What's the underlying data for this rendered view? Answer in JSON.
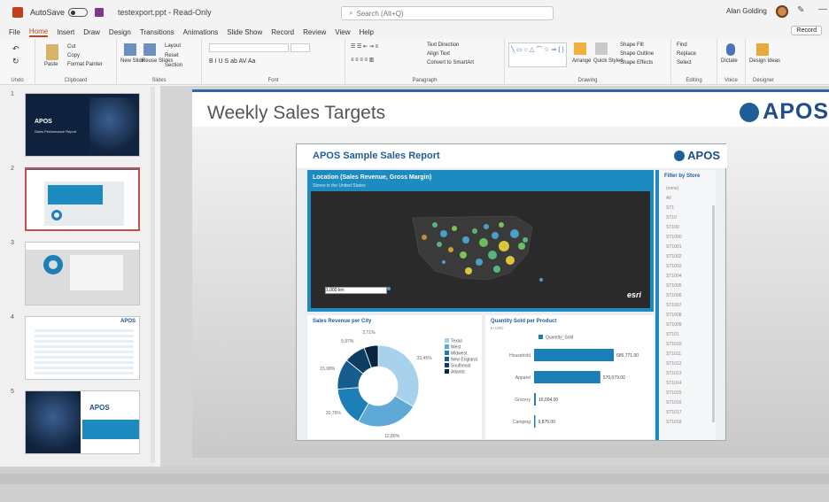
{
  "titlebar": {
    "autosave_label": "AutoSave",
    "autosave_state": "Off",
    "filename": "testexport.ppt - Read-Only",
    "search_placeholder": "Search (Alt+Q)",
    "user_name": "Alan Golding"
  },
  "menu": {
    "tabs": [
      "File",
      "Home",
      "Insert",
      "Draw",
      "Design",
      "Transitions",
      "Animations",
      "Slide Show",
      "Record",
      "Review",
      "View",
      "Help"
    ],
    "active": "Home",
    "record_button": "Record"
  },
  "ribbon": {
    "groups": [
      "Undo",
      "Clipboard",
      "Slides",
      "Font",
      "Paragraph",
      "Drawing",
      "Editing",
      "Voice",
      "Designer"
    ],
    "clipboard": {
      "paste": "Paste",
      "cut": "Cut",
      "copy": "Copy",
      "format_painter": "Format Painter"
    },
    "slides": {
      "new_slide": "New Slide",
      "reuse_slides": "Reuse Slides",
      "layout": "Layout",
      "reset": "Reset",
      "section": "Section"
    },
    "paragraph": {
      "text_direction": "Text Direction",
      "align_text": "Align Text",
      "convert": "Convert to SmartArt"
    },
    "drawing": {
      "arrange": "Arrange",
      "quick_styles": "Quick Styles",
      "shape_fill": "Shape Fill",
      "shape_outline": "Shape Outline",
      "shape_effects": "Shape Effects"
    },
    "editing": {
      "find": "Find",
      "replace": "Replace",
      "select": "Select"
    },
    "voice": {
      "dictate": "Dictate"
    },
    "designer": {
      "design_ideas": "Design Ideas"
    }
  },
  "thumbnails": [
    {
      "num": "1",
      "kind": "dark"
    },
    {
      "num": "2",
      "kind": "report",
      "selected": true
    },
    {
      "num": "3",
      "kind": "pie"
    },
    {
      "num": "4",
      "kind": "table"
    },
    {
      "num": "5",
      "kind": "dark-split"
    }
  ],
  "thumb_text": {
    "t1_title": "APOS",
    "t1_sub": "Sales Performance Report",
    "t5_logo": "APOS",
    "t4_logo": "APOS"
  },
  "slide": {
    "title": "Weekly Sales Targets",
    "logo": "APOS"
  },
  "report": {
    "title": "APOS Sample Sales Report",
    "logo": "APOS",
    "map_title": "Location (Sales Revenue, Gross Margin)",
    "map_subtitle": "Stores in the United States",
    "map_scale": "1,000 km",
    "esri": "esri",
    "filter_title": "Filter by Store",
    "filter_items": [
      "(none)",
      "All",
      "ST1",
      "ST10",
      "ST100",
      "ST1000",
      "ST1001",
      "ST1002",
      "ST1003",
      "ST1004",
      "ST1005",
      "ST1006",
      "ST1007",
      "ST1008",
      "ST1009",
      "ST101",
      "ST1010",
      "ST1011",
      "ST1012",
      "ST1013",
      "ST1014",
      "ST1015",
      "ST1016",
      "ST1017",
      "ST1018"
    ],
    "pie_title": "Sales Revenue per City",
    "bar_title": "Quantity Sold per Product",
    "bar_sub": "In USD",
    "bar_legend": "Quantity_Sold"
  },
  "chart_data": [
    {
      "type": "pie",
      "title": "Sales Revenue per City",
      "categories": [
        "Texas",
        "West",
        "Midwest",
        "New England",
        "Southeast",
        "Atlantic"
      ],
      "values": [
        33.45,
        24.7,
        15.6,
        12.1,
        8.5,
        5.6
      ],
      "colors": [
        "#a8d1ec",
        "#5fa9d6",
        "#1d7fb8",
        "#165d8d",
        "#0e3e63",
        "#0a2540"
      ],
      "labels": [
        "33,45%",
        "12,80%",
        "20,76%",
        "15,08%",
        "5,97%",
        "2,71%"
      ]
    },
    {
      "type": "bar",
      "title": "Quantity Sold per Product",
      "categories": [
        "Household",
        "Apparel",
        "Grocery",
        "Camping"
      ],
      "values": [
        685771,
        570079,
        15004,
        9875
      ],
      "labels": [
        "685,771.00",
        "570,079.00",
        "15,004.00",
        "9,875.00"
      ],
      "color": "#1d7fb8"
    }
  ]
}
